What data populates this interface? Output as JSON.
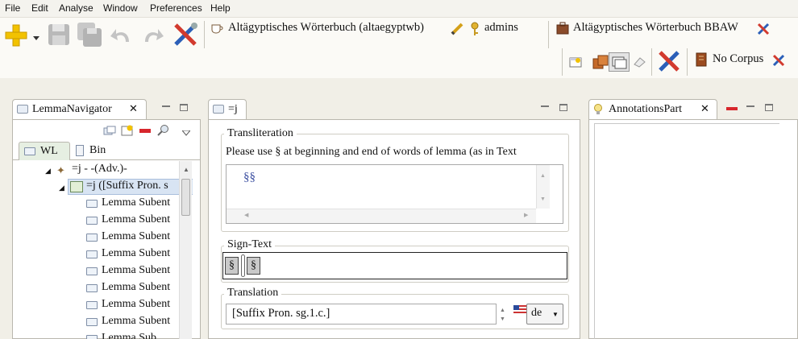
{
  "menu": [
    "File",
    "Edit",
    "Analyse",
    "Window",
    "Preferences",
    "Help"
  ],
  "toolbar": {
    "dictionary": "Altägyptisches Wörterbuch (altaegyptwb)",
    "user": "admins",
    "project": "Altägyptisches Wörterbuch BBAW",
    "corpus": "No Corpus"
  },
  "lemma_navigator": {
    "title": "LemmaNavigator",
    "tabs": [
      "WL",
      "Bin"
    ],
    "tree": [
      {
        "label": "=j - -(Adv.)-",
        "level": 0
      },
      {
        "label": "=j ([Suffix Pron. s",
        "level": 1
      },
      {
        "label": "Lemma Subent",
        "level": 2
      },
      {
        "label": "Lemma Subent",
        "level": 2
      },
      {
        "label": "Lemma Subent",
        "level": 2
      },
      {
        "label": "Lemma Subent",
        "level": 2
      },
      {
        "label": "Lemma Subent",
        "level": 2
      },
      {
        "label": "Lemma Subent",
        "level": 2
      },
      {
        "label": "Lemma Subent",
        "level": 2
      },
      {
        "label": "Lemma Subent",
        "level": 2
      },
      {
        "label": "Lemma Sub",
        "level": 2
      }
    ]
  },
  "editor": {
    "tab": "=j",
    "transliteration": {
      "label": "Transliteration",
      "hint": "Please use § at beginning and end of words of lemma (as in Text",
      "value": "§§"
    },
    "sign_text": {
      "label": "Sign-Text",
      "glyphs": [
        "§",
        "§"
      ]
    },
    "translation": {
      "label": "Translation",
      "value": "[Suffix Pron. sg.1.c.]",
      "language": "de"
    }
  },
  "annotations": {
    "title": "AnnotationsPart"
  }
}
